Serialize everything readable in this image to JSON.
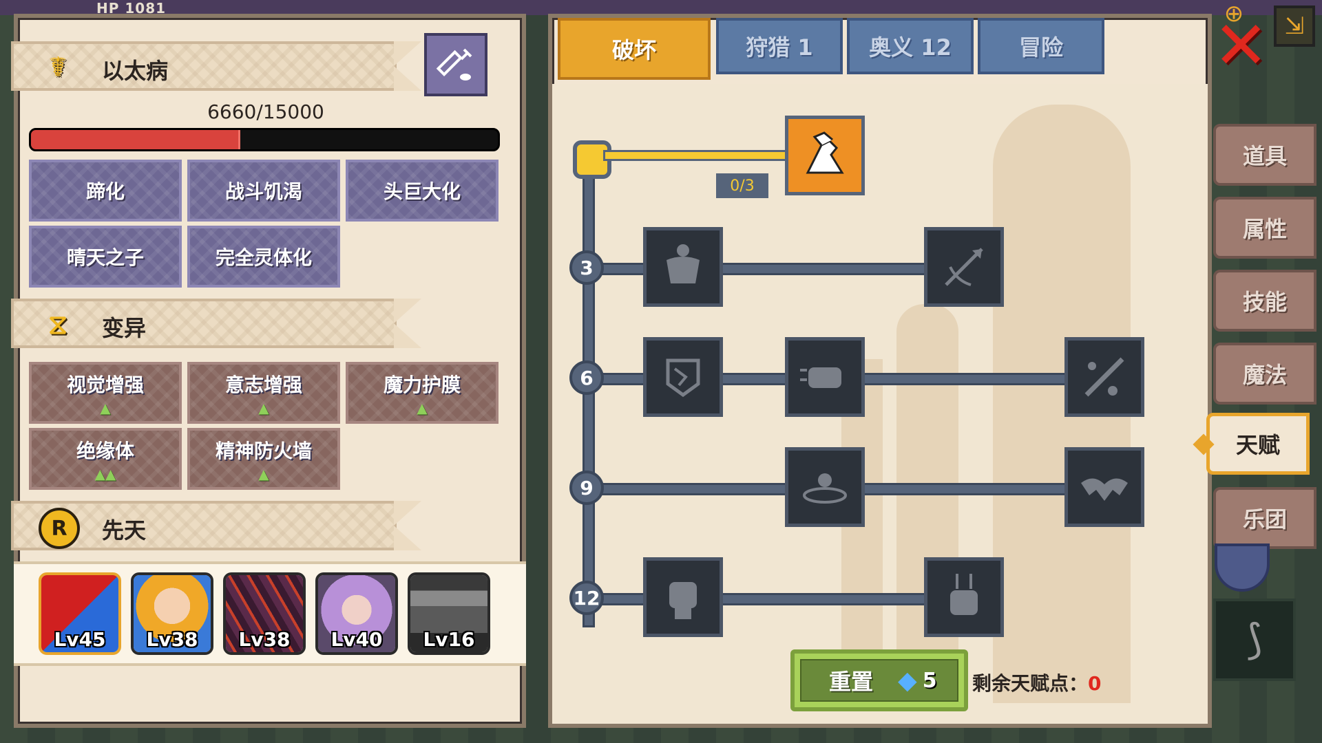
{
  "hud": {
    "hp_text": "HP   1081"
  },
  "left": {
    "disease": {
      "title": "以太病",
      "icon": "caduceus-icon"
    },
    "hp_label": "6660/15000",
    "hp_fraction": 0.444,
    "disease_tags": [
      "蹄化",
      "战斗饥渴",
      "头巨大化",
      "晴天之子",
      "完全灵体化"
    ],
    "mutation": {
      "title": "变异",
      "icon": "dna-icon"
    },
    "mutation_tags": [
      {
        "label": "视觉增强",
        "marks": "▲"
      },
      {
        "label": "意志增强",
        "marks": "▲"
      },
      {
        "label": "魔力护膜",
        "marks": "▲"
      },
      {
        "label": "绝缘体",
        "marks": "▲▲"
      },
      {
        "label": "精神防火墙",
        "marks": "▲"
      }
    ],
    "innate": {
      "title": "先天",
      "icon": "r-coin-icon"
    },
    "characters": [
      {
        "level": "Lv45"
      },
      {
        "level": "Lv38"
      },
      {
        "level": "Lv38"
      },
      {
        "level": "Lv40"
      },
      {
        "level": "Lv16"
      }
    ]
  },
  "tabs": {
    "active": "破坏",
    "hunt": "狩猎 1",
    "arcane": "奥义 12",
    "adventure": "冒险"
  },
  "tree": {
    "levels": [
      "3",
      "6",
      "9",
      "12"
    ],
    "top_skill_counter": "0/3"
  },
  "footer": {
    "reset_label": "重置",
    "gem_count": "5",
    "remaining_label": "剩余天赋点：",
    "remaining_value": "0"
  },
  "sidebar": [
    "道具",
    "属性",
    "技能",
    "魔法",
    "天赋",
    "乐团"
  ],
  "sidebar_active": "天赋"
}
